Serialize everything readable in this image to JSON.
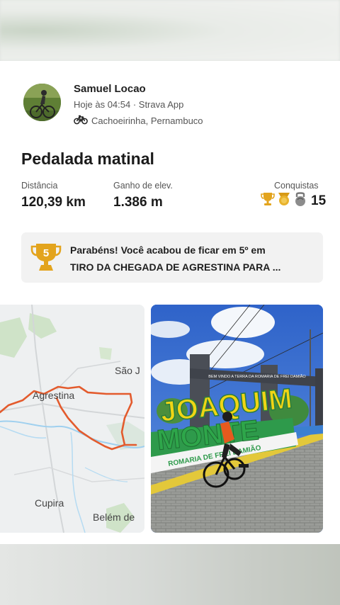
{
  "activity": {
    "athlete_name": "Samuel Locao",
    "time_source": "Hoje às 04:54 · Strava App",
    "location": "Cachoeirinha, Pernambuco",
    "activity_icon": "bike-icon",
    "title": "Pedalada matinal"
  },
  "stats": {
    "distance_label": "Distância",
    "distance_value": "120,39 km",
    "elevation_label": "Ganho de elev.",
    "elevation_value": "1.386 m",
    "achievements_label": "Conquistas",
    "achievements_count": "15"
  },
  "achievement_banner": {
    "rank_badge": "5",
    "line1": "Parabéns! Você acabou de ficar em 5º em",
    "line2": "TIRO DA CHEGADA DE AGRESTINA PARA ..."
  },
  "map": {
    "labels": {
      "sao_j": "São J",
      "agrestina": "Agrestina",
      "cupira": "Cupira",
      "belem": "Belém de"
    },
    "route_color": "#e35b2d"
  },
  "photo": {
    "sign_text": "JOAQUIM",
    "sign_text2": "MONTE",
    "arch_text": "BEM VINDO A TERRA DA ROMARIA DE FREI DAMIÃO",
    "base_text": "ROMARIA DE FREI DAMIÃO"
  },
  "colors": {
    "gold": "#e3a41d",
    "text": "#1b1b1b",
    "muted": "#555555"
  }
}
